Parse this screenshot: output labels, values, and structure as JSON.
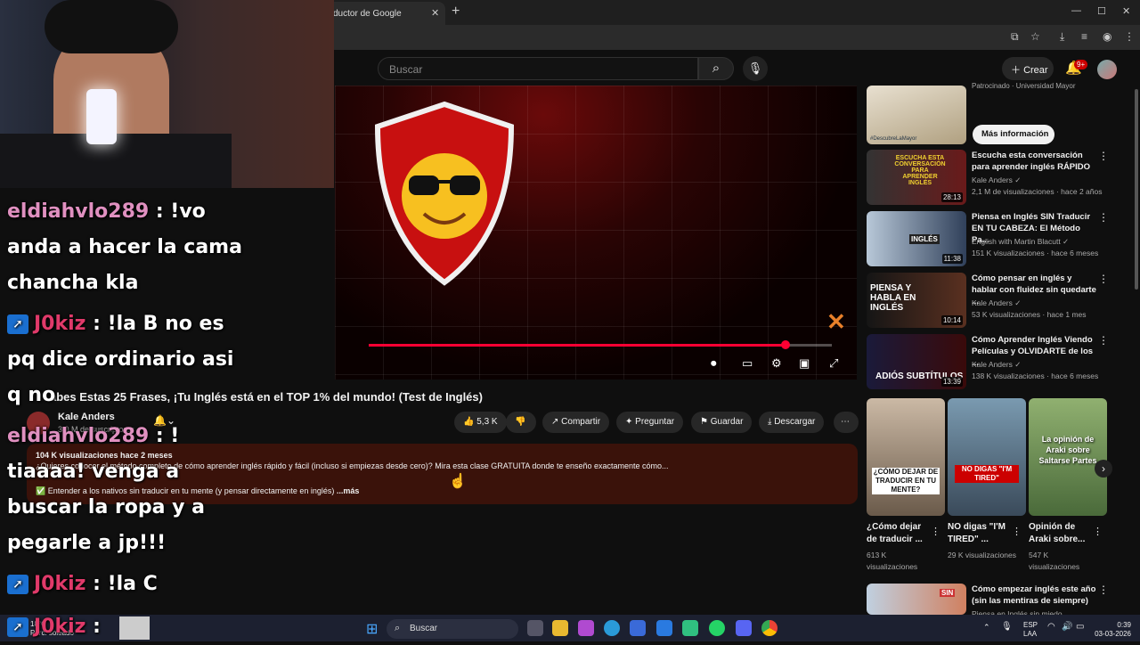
{
  "browser": {
    "tab_title": "ductor de Google",
    "tab_close": "✕",
    "new_tab": "+",
    "win_min": "—",
    "win_max": "☐",
    "win_close": "✕"
  },
  "header": {
    "search_placeholder": "Buscar",
    "create_label": "Crear",
    "notification_count": "9+"
  },
  "video": {
    "title": "abes Estas 25 Frases, ¡Tu Inglés está en el TOP 1% del mundo! (Test de Inglés)",
    "channel": "Kale Anders",
    "subscribers": "3,0 M de suscriptores",
    "progress": 0.9,
    "likes": "5,3 K",
    "share_label": "Compartir",
    "ask_label": "Preguntar",
    "save_label": "Guardar",
    "download_label": "Descargar",
    "desc_meta": "104 K visualizaciones  hace 2 meses",
    "desc_line1": "¿Quieres conocer el método completo de cómo aprender inglés rápido y fácil (incluso si empiezas desde cero)? Mira esta clase GRATUITA donde te enseño exactamente cómo...",
    "desc_line2": "✅ Entender a los nativos sin traducir en tu mente (y pensar directamente en inglés)",
    "desc_more": "...más"
  },
  "sidebar": {
    "ad": {
      "top_text": "Patrocinado · Universidad Mayor",
      "thumb_caption": "#DescubreLaMayor",
      "button": "Más información"
    },
    "recs": [
      {
        "title": "Escucha esta conversación para aprender inglés RÁPIDO",
        "channel": "Kale Anders ✓",
        "meta": "2,1 M de visualizaciones · hace 2 años",
        "duration": "28:13",
        "thumb_text": "ESCUCHA ESTA CONVERSACIÓN PARA APRENDER INGLÉS"
      },
      {
        "title": "Piensa en Inglés SIN Traducir EN TU CABEZA: El Método Pa...",
        "channel": "English with Martin Blacutt ✓",
        "meta": "151 K visualizaciones · hace 6 meses",
        "duration": "11:38",
        "thumb_text": "INGLÉS"
      },
      {
        "title": "Cómo pensar en inglés y hablar con fluidez sin quedarte ...",
        "channel": "Kale Anders ✓",
        "meta": "53 K visualizaciones · hace 1 mes",
        "duration": "10:14",
        "thumb_text": "PIENSA Y HABLA EN INGLÉS"
      },
      {
        "title": "Cómo Aprender Inglés Viendo Películas y OLVIDARTE de los ...",
        "channel": "Kale Anders ✓",
        "meta": "138 K visualizaciones · hace 6 meses",
        "duration": "13:39",
        "thumb_text": "ADIÓS SUBTÍTULOS"
      },
      {
        "title": "Cómo empezar inglés este año (sin las mentiras de siempre)",
        "channel": "Piensa en Inglés sin miedo",
        "meta": "",
        "duration": "",
        "thumb_text": "SIN"
      }
    ],
    "shorts": [
      {
        "title": "¿Cómo dejar de traducir ...",
        "views": "613 K visualizaciones",
        "thumb_text": "¿CÓMO DEJAR DE TRADUCIR EN TU MENTE?"
      },
      {
        "title": "NO digas \"I'M TIRED\" ...",
        "views": "29 K visualizaciones",
        "thumb_text": "NO DIGAS \"I'M TIRED\""
      },
      {
        "title": "Opinión de Araki sobre...",
        "views": "547 K visualizaciones",
        "thumb_text": "La opinión de Araki sobre Saltarse Partes"
      }
    ]
  },
  "chat": [
    {
      "user": "eldiahvlo289",
      "text1": " : !vo",
      "text2": "anda a hacer la cama",
      "text3": "chancha kla"
    },
    {
      "user": "J0kiz",
      "text1": " : !la B no es",
      "text2": "pq dice ordinario asi",
      "text3": "q no"
    },
    {
      "user": "eldiahvlo289",
      "text1": " : !",
      "text2": "tiaaaa! venga a",
      "text3": "buscar la ropa y a",
      "text4": "pegarle a jp!!!"
    },
    {
      "user": "J0kiz",
      "text1": " : !la C"
    },
    {
      "user": "J0kiz",
      "text1": " :"
    }
  ],
  "taskbar": {
    "search": "Buscar",
    "weather_temp": "18°C",
    "weather_desc": "Parc. soleado",
    "lang1": "ESP",
    "lang2": "LAA",
    "time": "0:39",
    "date": "03-03-2026"
  },
  "colors": {
    "yt_bg": "#0f0f0f",
    "accent_red": "#ff0033",
    "chat_user1": "#e090c0",
    "chat_user2": "#e03a6a",
    "desc_bg": "#3a120a"
  }
}
